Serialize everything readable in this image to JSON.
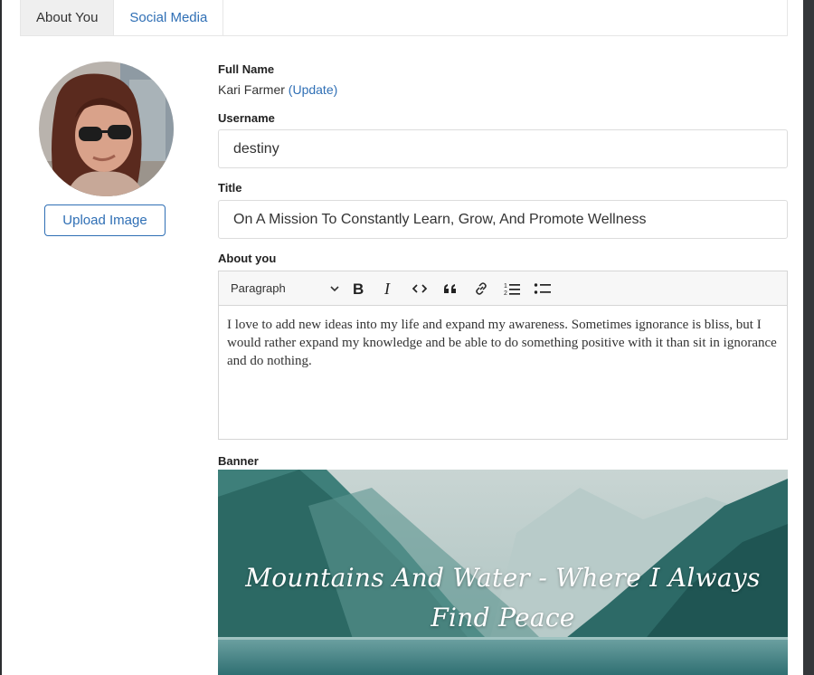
{
  "tabs": [
    {
      "label": "About You",
      "active": true
    },
    {
      "label": "Social Media",
      "active": false
    }
  ],
  "profile": {
    "upload_label": "Upload Image"
  },
  "form": {
    "full_name_label": "Full Name",
    "full_name_value": "Kari Farmer",
    "update_link": "(Update)",
    "username_label": "Username",
    "username_value": "destiny",
    "title_label": "Title",
    "title_value": "On A Mission To Constantly Learn, Grow, And Promote Wellness",
    "about_label": "About you",
    "about_text": "I love to add new ideas into my life and expand my awareness. Sometimes ignorance is bliss, but I would rather expand my knowledge and be able to do something positive with it than sit in ignorance and do nothing.",
    "banner_label": "Banner"
  },
  "editor_toolbar": {
    "block_format": "Paragraph",
    "buttons": [
      "bold-icon",
      "italic-icon",
      "code-icon",
      "quote-icon",
      "link-icon",
      "numbered-list-icon",
      "bulleted-list-icon"
    ]
  },
  "banner": {
    "text": "Mountains And Water - Where I Always Find Peace"
  },
  "colors": {
    "accent": "#2f6fb5",
    "backdrop": "#3a3d40"
  }
}
